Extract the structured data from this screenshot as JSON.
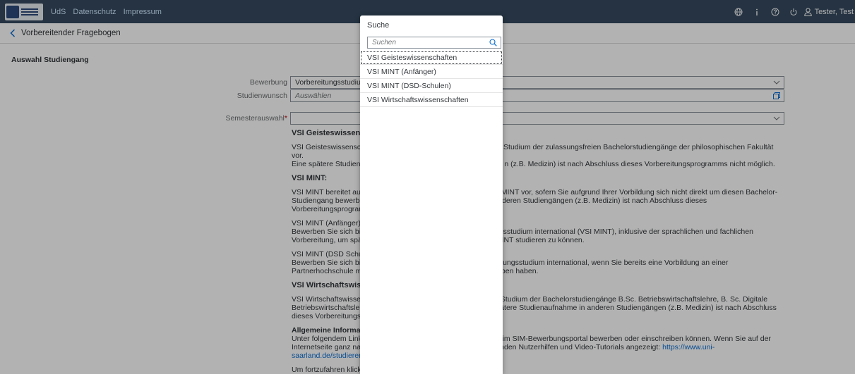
{
  "shell": {
    "links": [
      "UdS",
      "Datenschutz",
      "Impressum"
    ],
    "user": "Tester, Test",
    "icons": [
      "globe-icon",
      "info-icon",
      "help-icon",
      "power-icon",
      "user-icon"
    ]
  },
  "page": {
    "title": "Vorbereitender Fragebogen",
    "section": "Auswahl Studiengang"
  },
  "form": {
    "bewerbung_label": "Bewerbung",
    "bewerbung_value": "Vorbereitungsstudium I",
    "studienwunsch_label": "Studienwunsch",
    "studienwunsch_placeholder": "Auswählen",
    "semester_label": "Semesterauswahl",
    "semester_required": "*"
  },
  "content": {
    "h1": "VSI Geisteswissensc",
    "p1a": "VSI Geisteswissensch",
    "p1b": "s Studium der zulassungsfreien Bachelorstudiengänge der philosophischen Fakultät vor.",
    "p1c": "Eine spätere Studiena",
    "p1d": "n (z.B. Medizin) ist nach Abschluss dieses Vorbereitungsprogramms nicht möglich.",
    "h2": "VSI MINT:",
    "p2a": "VSI MINT bereitet auf",
    "p2b": "us MINT vor, sofern Sie aufgrund Ihrer Vorbildung sich nicht direkt um diesen Bachelor-",
    "p2c": "Studiengang bewerbe",
    "p2d": "nderen Studiengängen (z.B. Medizin) ist nach Abschluss dieses",
    "p2e": "Vorbereitungsprogram",
    "p3a": "VSI MINT (Anfänger):",
    "p3b": "Bewerben Sie sich bit",
    "p3c": "ngsstudium international (VSI MINT), inklusive der sprachlichen und fachlichen",
    "p3d": "Vorbereitung, um spä",
    "p3e": "MINT studieren zu können.",
    "p4a": "VSI MINT (DSD Schul",
    "p4b": "Bewerben Sie sich bit",
    "p4c": "eitungsstudium international, wenn Sie bereits eine Vorbildung an einer",
    "p4d": "Partnerhochschule mi",
    "p4e": "orben haben.",
    "h3": "VSI Wirtschaftswisse",
    "p5a": "VSI Wirtschaftswissen",
    "p5b": "as Studium der Bachelorstudiengänge B.Sc. Betriebswirtschaftslehre, B. Sc. Digitale",
    "p5c": "Betriebswirtschaftsleh",
    "p5d": "spätere Studienaufnahme in anderen Studiengängen (z.B. Medizin) ist nach Abschluss",
    "p5e": "dieses Vorbereitungsp",
    "h4": "Allgemeine Informat",
    "p6a": "Unter folgendem Link",
    "p6b": "n im SIM-Bewerbungsportal bewerben oder einschreiben können. Wenn Sie auf der",
    "p6c": "Internetseite ganz nac",
    "p6d": "enden Nutzerhilfen und Video-Tutorials angezeigt: ",
    "p6link": "https://www.uni-",
    "p6link2": "saarland.de/studieren",
    "p7": "Um fortzufahren klick"
  },
  "popup": {
    "title": "Suche",
    "search_placeholder": "Suchen",
    "options": [
      "VSI Geisteswissenschaften",
      "VSI MINT (Anfänger)",
      "VSI MINT (DSD-Schulen)",
      "VSI Wirtschaftswissenschaften"
    ]
  }
}
